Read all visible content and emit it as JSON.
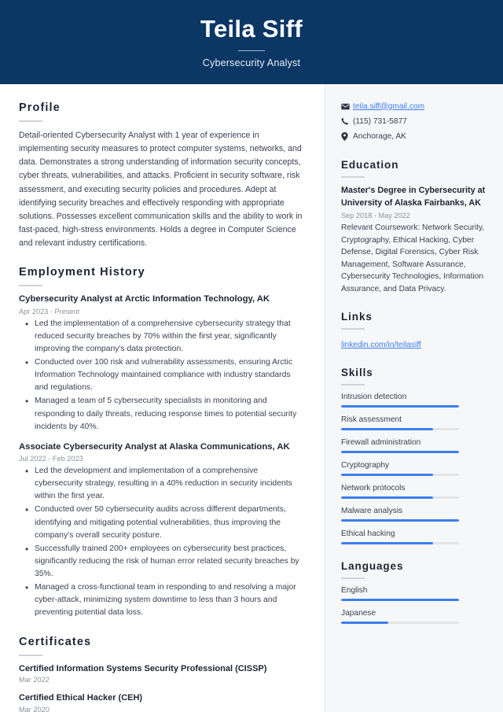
{
  "header": {
    "name": "Teila Siff",
    "title": "Cybersecurity Analyst",
    "bg_color": "#0b3765"
  },
  "theme": {
    "accent": "#3d7ef0",
    "heading": "#1d2433",
    "muted": "#8b919c",
    "sidebar_bg": "#f6f7f8"
  },
  "profile": {
    "heading": "Profile",
    "text": "Detail-oriented Cybersecurity Analyst with 1 year of experience in implementing security measures to protect computer systems, networks, and data. Demonstrates a strong understanding of information security concepts, cyber threats, vulnerabilities, and attacks. Proficient in security software, risk assessment, and executing security policies and procedures. Adept at identifying security breaches and effectively responding with appropriate solutions. Possesses excellent communication skills and the ability to work in fast-paced, high-stress environments. Holds a degree in Computer Science and relevant industry certifications."
  },
  "employment": {
    "heading": "Employment History",
    "jobs": [
      {
        "title": "Cybersecurity Analyst at Arctic Information Technology, AK",
        "date": "Apr 2023 - Present",
        "bullets": [
          "Led the implementation of a comprehensive cybersecurity strategy that reduced security breaches by 70% within the first year, significantly improving the company's data protection.",
          "Conducted over 100 risk and vulnerability assessments, ensuring Arctic Information Technology maintained compliance with industry standards and regulations.",
          "Managed a team of 5 cybersecurity specialists in monitoring and responding to daily threats, reducing response times to potential security incidents by 40%."
        ]
      },
      {
        "title": "Associate Cybersecurity Analyst at Alaska Communications, AK",
        "date": "Jul 2022 - Feb 2023",
        "bullets": [
          "Led the development and implementation of a comprehensive cybersecurity strategy, resulting in a 40% reduction in security incidents within the first year.",
          "Conducted over 50 cybersecurity audits across different departments, identifying and mitigating potential vulnerabilities, thus improving the company's overall security posture.",
          "Successfully trained 200+ employees on cybersecurity best practices, significantly reducing the risk of human error related security breaches by 35%.",
          "Managed a cross-functional team in responding to and resolving a major cyber-attack, minimizing system downtime to less than 3 hours and preventing potential data loss."
        ]
      }
    ]
  },
  "certificates": {
    "heading": "Certificates",
    "items": [
      {
        "name": "Certified Information Systems Security Professional (CISSP)",
        "date": "Mar 2022"
      },
      {
        "name": "Certified Ethical Hacker (CEH)",
        "date": "Mar 2020"
      }
    ]
  },
  "contact": {
    "items": [
      {
        "icon": "envelope-icon",
        "text": "teila.siff@gmail.com",
        "is_link": true
      },
      {
        "icon": "phone-icon",
        "text": "(115) 731-5877",
        "is_link": false
      },
      {
        "icon": "location-pin-icon",
        "text": "Anchorage, AK",
        "is_link": false
      }
    ]
  },
  "education": {
    "heading": "Education",
    "degree": "Master's Degree in Cybersecurity at University of Alaska Fairbanks, AK",
    "date": "Sep 2018 - May 2022",
    "description": "Relevant Coursework: Network Security, Cryptography, Ethical Hacking, Cyber Defense, Digital Forensics, Cyber Risk Management, Software Assurance, Cybersecurity Technologies, Information Assurance, and Data Privacy."
  },
  "links": {
    "heading": "Links",
    "items": [
      {
        "label": "linkedin.com/in/teilasiff"
      }
    ]
  },
  "skills": {
    "heading": "Skills",
    "items": [
      {
        "label": "Intrusion detection",
        "level": 100
      },
      {
        "label": "Risk assessment",
        "level": 78
      },
      {
        "label": "Firewall administration",
        "level": 100
      },
      {
        "label": "Cryptography",
        "level": 78
      },
      {
        "label": "Network protocols",
        "level": 78
      },
      {
        "label": "Malware analysis",
        "level": 100
      },
      {
        "label": "Ethical hacking",
        "level": 78
      }
    ]
  },
  "languages": {
    "heading": "Languages",
    "items": [
      {
        "label": "English",
        "level": 100
      },
      {
        "label": "Japanese",
        "level": 40
      }
    ]
  }
}
